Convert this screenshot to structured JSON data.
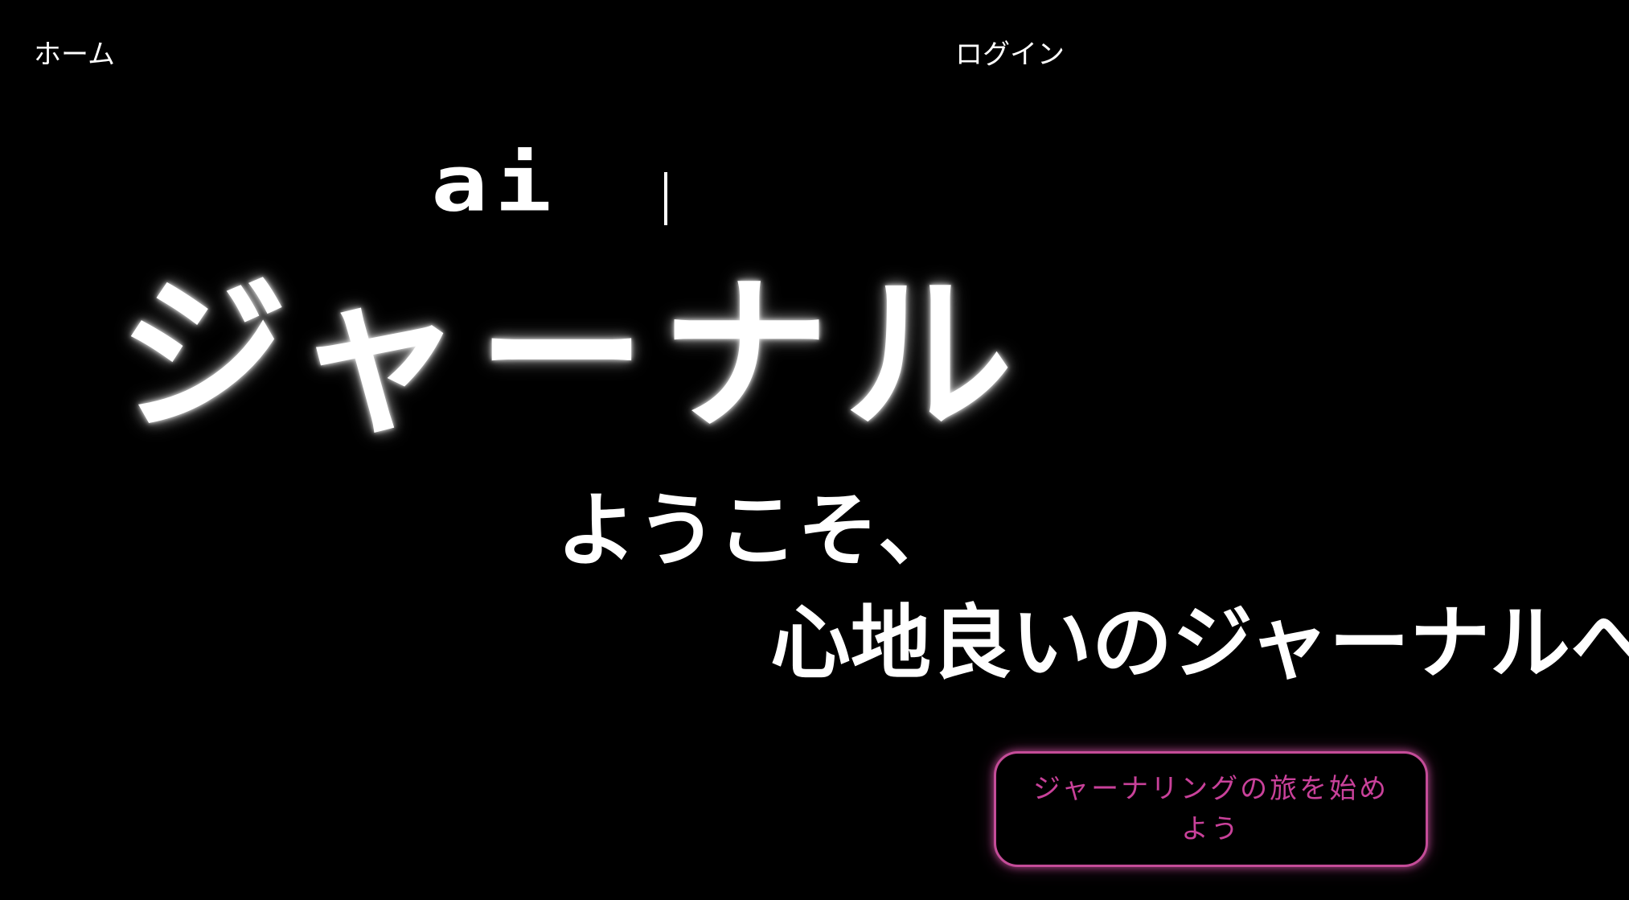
{
  "nav": {
    "home_label": "ホーム",
    "login_label": "ログイン"
  },
  "logo": {
    "text": "ai"
  },
  "hero": {
    "title": "ジャーナル",
    "welcome_line1": "ようこそ、",
    "welcome_line2": "心地良いのジャーナルへ"
  },
  "cta": {
    "label": "ジャーナリングの旅を始めよう"
  },
  "colors": {
    "background": "#000000",
    "text": "#ffffff",
    "accent_pink": "#c9419a",
    "border_pink": "#c44c98"
  }
}
